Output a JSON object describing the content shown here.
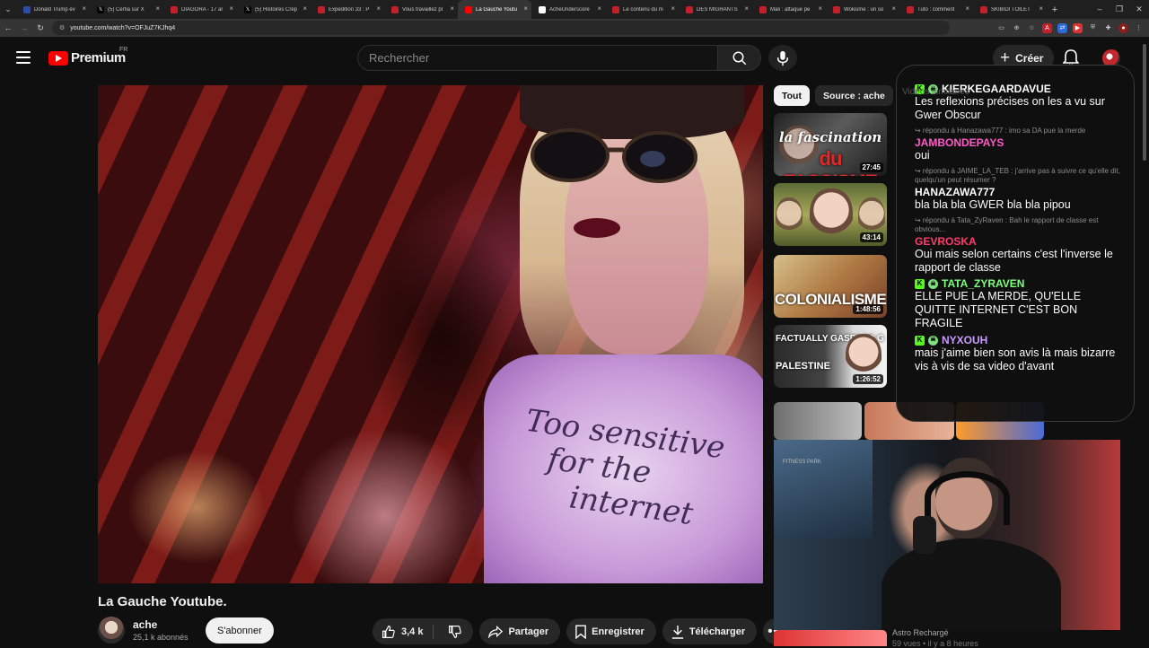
{
  "browser": {
    "tabs": [
      {
        "title": "Donald Trump év",
        "color": "#2b4ea8"
      },
      {
        "title": "(5) Cerfia sur X",
        "color": "#000000",
        "x": true
      },
      {
        "title": "DIAGORA - 17 ar",
        "color": "#c4202b"
      },
      {
        "title": "(5) Histoires Crép",
        "color": "#000000",
        "x": true
      },
      {
        "title": "Expedition 33 : P",
        "color": "#c4202b"
      },
      {
        "title": "Vous travaillez pl",
        "color": "#c4202b"
      },
      {
        "title": "La Gauche Youtu",
        "color": "#ff0000",
        "active": true
      },
      {
        "title": "AcheUnderscore",
        "color": "#ffffff"
      },
      {
        "title": "Le contenu du m",
        "color": "#c4202b"
      },
      {
        "title": "DES MIGRANTS",
        "color": "#c4202b"
      },
      {
        "title": "Mali : attaque pe",
        "color": "#c4202b"
      },
      {
        "title": "Wokisme : un so",
        "color": "#c4202b"
      },
      {
        "title": "Tuto : comment",
        "color": "#c4202b"
      },
      {
        "title": "SKIBIDI TOILET",
        "color": "#c4202b"
      }
    ],
    "url": "youtube.com/watch?v=OFJuZ7KJhq4"
  },
  "masthead": {
    "logo_text": "Premium",
    "country": "FR",
    "search_placeholder": "Rechercher",
    "create_label": "Créer"
  },
  "video": {
    "title": "La Gauche Youtube.",
    "shirt_text_line1": "Too sensitive",
    "shirt_text_line2": "for the",
    "shirt_text_line3": "internet"
  },
  "channel": {
    "name": "ache",
    "subscribers": "25,1 k abonnés",
    "subscribe_label": "S'abonner"
  },
  "actions": {
    "like_count": "3,4 k",
    "share_label": "Partager",
    "save_label": "Enregistrer",
    "download_label": "Télécharger"
  },
  "chips": [
    "Tout",
    "Source : ache"
  ],
  "related": [
    {
      "duration": "27:45",
      "thumb_text_1": "la fascination",
      "thumb_text_2": "du FASCISME"
    },
    {
      "duration": "43:14"
    },
    {
      "duration": "1:48:56",
      "thumb_text_1": "COLONIALISME"
    },
    {
      "duration": "1:26:52",
      "thumb_text_1": "FACTUALLY GASPARD G",
      "thumb_text_2": "PALESTINE"
    }
  ],
  "chat": {
    "ghost": "Vidéos similaires",
    "messages": [
      {
        "reply": "",
        "author": "KIERKEGAARDAVUE",
        "author_color": "#ffffff",
        "badges": true,
        "text": "Les reflexions précises on les a vu sur Gwer Obscur"
      },
      {
        "reply": "↪ répondu à Hanazawa777 : imo sa DA pue la merde",
        "author": "JAMBONDEPAYS",
        "author_color": "#ff5ac8",
        "badges": false,
        "text": "oui"
      },
      {
        "reply": "↪ répondu à JAIME_LA_TEB : j'arrive pas à suivre ce qu'elle dit, quelqu'un peut résumer ?",
        "author": "HANAZAWA777",
        "author_color": "#ffffff",
        "badges": false,
        "text": "bla bla bla GWER bla bla pipou"
      },
      {
        "reply": "↪ répondu à Tata_ZyRaven : Bah le rapport de classe est obvious...",
        "author": "GEVROSKA",
        "author_color": "#ff3b6b",
        "badges": false,
        "text": "Oui mais selon certains c'est l'inverse le rapport de classe"
      },
      {
        "reply": "",
        "author": "TATA_ZYRAVEN",
        "author_color": "#7dff7d",
        "badges": true,
        "text": "ELLE PUE LA MERDE, QU'ELLE QUITTE INTERNET C'EST BON FRAGILE"
      },
      {
        "reply": "",
        "author": "NYXOUH",
        "author_color": "#c99cff",
        "badges": true,
        "text": "mais j'aime bien son avis là mais bizarre vis à vis de sa video d'avant"
      }
    ]
  },
  "webcam": {
    "poster_text": "FITNESS PARK",
    "below_title": "Astro Rechargé",
    "below_meta": "59 vues • il y a 8 heures"
  }
}
